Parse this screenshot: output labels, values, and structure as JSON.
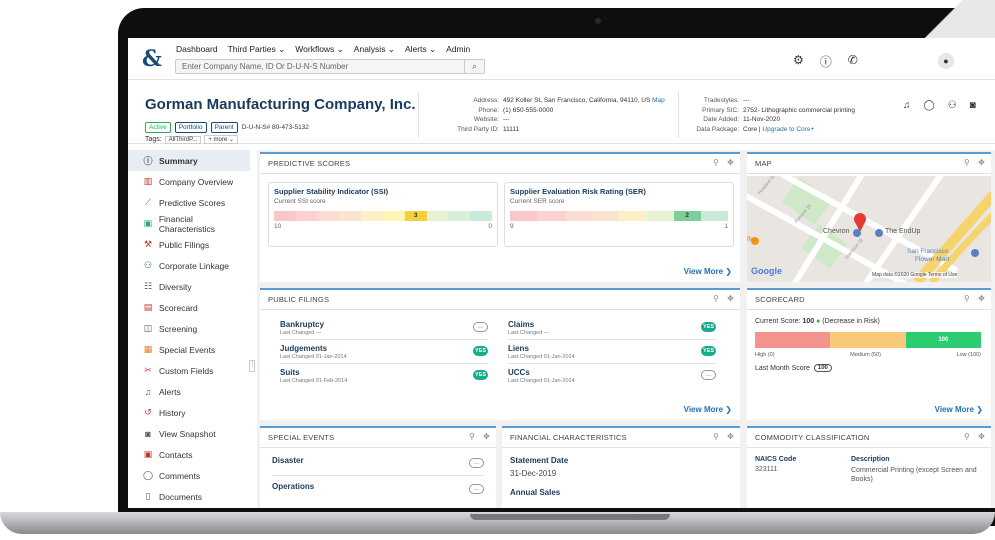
{
  "nav": {
    "links": [
      "Dashboard",
      "Third Parties ⌄",
      "Workflows ⌄",
      "Analysis ⌄",
      "Alerts ⌄",
      "Admin"
    ],
    "search_placeholder": "Enter Company Name, ID Or D-U-N-S Number",
    "icons": [
      "gear-icon",
      "help-icon",
      "phone-icon",
      "user-icon"
    ]
  },
  "company": {
    "name": "Gorman Manufacturing Company, Inc.",
    "badges": {
      "active": "Active",
      "portfolio": "Portfolio",
      "parent": "Parent"
    },
    "duns": "D-U-N-S# 80-473-5132",
    "tags_label": "Tags:",
    "tag": "AllThirdP...",
    "more": "+ more ⌄",
    "address_label": "Address:",
    "address": "492 Koller St, San Francisco, California, 94110, US",
    "map_link": "Map",
    "phone_label": "Phone:",
    "phone": "(1) 650-555-0000",
    "website_label": "Website:",
    "website": "---",
    "tpid_label": "Third Party ID:",
    "tpid": "11111",
    "tradestyles_label": "Tradestyles:",
    "tradestyles": "---",
    "sic_label": "Primary SIC:",
    "sic": "2752- Lithographic commercial printing",
    "date_label": "Date Added:",
    "date": "11-Nov-2020",
    "package_label": "Data Package:",
    "package": "Core | ",
    "upgrade": "Upgrade to Core+"
  },
  "sidebar": {
    "items": [
      {
        "label": "Summary",
        "icon": "info-icon"
      },
      {
        "label": "Company Overview",
        "icon": "building-icon"
      },
      {
        "label": "Predictive Scores",
        "icon": "chart-icon"
      },
      {
        "label": "Financial Characteristics",
        "icon": "money-icon"
      },
      {
        "label": "Public Filings",
        "icon": "gavel-icon"
      },
      {
        "label": "Corporate Linkage",
        "icon": "hierarchy-icon"
      },
      {
        "label": "Diversity",
        "icon": "people-icon"
      },
      {
        "label": "Scorecard",
        "icon": "scorecard-icon"
      },
      {
        "label": "Screening",
        "icon": "screening-icon"
      },
      {
        "label": "Special Events",
        "icon": "calendar-icon"
      },
      {
        "label": "Custom Fields",
        "icon": "custom-icon"
      },
      {
        "label": "Alerts",
        "icon": "bell-icon"
      },
      {
        "label": "History",
        "icon": "history-icon"
      },
      {
        "label": "View Snapshot",
        "icon": "camera-icon"
      },
      {
        "label": "Contacts",
        "icon": "contact-icon"
      },
      {
        "label": "Comments",
        "icon": "comment-icon"
      },
      {
        "label": "Documents",
        "icon": "document-icon"
      }
    ]
  },
  "predictive": {
    "title": "PREDICTIVE SCORES",
    "ssi_title": "Supplier Stability Indicator (SSI)",
    "ssi_sub": "Current SSI score",
    "ssi_score": "3",
    "ssi_low": "10",
    "ssi_high": "0",
    "ser_title": "Supplier Evaluation Risk Rating (SER)",
    "ser_sub": "Current SER score",
    "ser_score": "2",
    "ser_low": "9",
    "ser_high": "1",
    "view_more": "View More ❯"
  },
  "map": {
    "title": "MAP",
    "labels": {
      "chevron": "Chevron",
      "endup": "The EndUp",
      "sf": "San Francisco",
      "flower": "Flower Mart",
      "google": "Google",
      "attr": "Map data ©2020 Google   Terms of Use",
      "folsom": "Folsom St",
      "harrison": "Harrison St",
      "howard": "Howard St",
      "fee": "ffee"
    }
  },
  "filings": {
    "title": "PUBLIC FILINGS",
    "rows": [
      {
        "t": "Bankruptcy",
        "s": "Last Changed ---",
        "v": "—"
      },
      {
        "t": "Claims",
        "s": "Last Changed ---",
        "v": "YES"
      },
      {
        "t": "Judgements",
        "s": "Last Changed 01-Jan-2014",
        "v": "YES"
      },
      {
        "t": "Liens",
        "s": "Last Changed 01-Jan-2014",
        "v": "YES"
      },
      {
        "t": "Suits",
        "s": "Last Changed 01-Feb-2014",
        "v": "YES"
      },
      {
        "t": "UCCs",
        "s": "Last Changed 01-Jan-2014",
        "v": "—"
      }
    ],
    "view_more": "View More ❯"
  },
  "scorecard": {
    "title": "SCORECARD",
    "current_label": "Current Score: ",
    "current": "100",
    "decrease": "(Decrease in Risk)",
    "bar_value": "100",
    "high": "High (0)",
    "medium": "Medium (50)",
    "low": "Low (100)",
    "last_label": "Last Month Score",
    "last": "100",
    "view_more": "View More ❯"
  },
  "special": {
    "title": "SPECIAL EVENTS",
    "rows": [
      "Disaster",
      "Operations"
    ]
  },
  "financial": {
    "title": "FINANCIAL CHARACTERISTICS",
    "statement_label": "Statement Date",
    "statement": "31-Dec-2019",
    "sales_label": "Annual Sales"
  },
  "commodity": {
    "title": "COMMODITY CLASSIFICATION",
    "naics_label": "NAICS Code",
    "naics": "323111",
    "desc_label": "Description",
    "desc": "Commercial Printing (except Screen and Books)"
  }
}
